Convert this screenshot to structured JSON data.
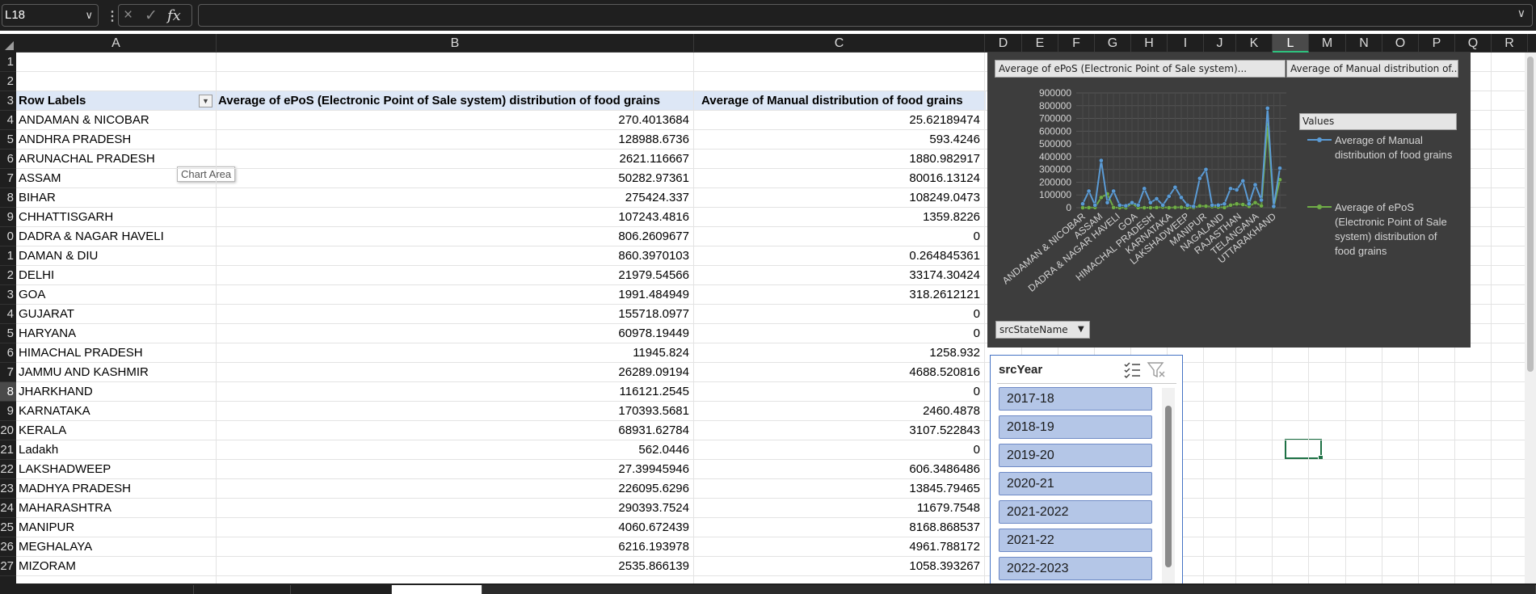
{
  "formula_bar": {
    "name_box": "L18",
    "dropdown_icon": "chevron-down-icon",
    "separator": "⋮",
    "cancel_icon": "×",
    "enter_icon": "✓",
    "fx_label": "fx",
    "formula": ""
  },
  "columns": [
    "A",
    "B",
    "C",
    "D",
    "E",
    "F",
    "G",
    "H",
    "I",
    "J",
    "K",
    "L",
    "M",
    "N",
    "O",
    "P",
    "Q",
    "R"
  ],
  "selected_column": "L",
  "selected_row": "18",
  "row_numbers": [
    "1",
    "2",
    "3",
    "4",
    "5",
    "6",
    "7",
    "8",
    "9",
    "0",
    "1",
    "2",
    "3",
    "4",
    "5",
    "6",
    "7",
    "8",
    "9",
    "20",
    "21",
    "22",
    "23",
    "24",
    "25",
    "26",
    "27"
  ],
  "pivot": {
    "headers": {
      "row_labels": "Row Labels",
      "epos": "Average of ePoS (Electronic Point of Sale system) distribution of food grains",
      "manual": "Average of Manual distribution of food grains"
    },
    "rows": [
      {
        "label": "ANDAMAN & NICOBAR",
        "epos": "270.4013684",
        "manual": "25.62189474"
      },
      {
        "label": "ANDHRA PRADESH",
        "epos": "128988.6736",
        "manual": "593.4246"
      },
      {
        "label": "ARUNACHAL PRADESH",
        "epos": "2621.116667",
        "manual": "1880.982917"
      },
      {
        "label": "ASSAM",
        "epos": "50282.97361",
        "manual": "80016.13124"
      },
      {
        "label": "BIHAR",
        "epos": "275424.337",
        "manual": "108249.0473"
      },
      {
        "label": "CHHATTISGARH",
        "epos": "107243.4816",
        "manual": "1359.8226"
      },
      {
        "label": "DADRA & NAGAR HAVELI",
        "epos": "806.2609677",
        "manual": "0"
      },
      {
        "label": "DAMAN & DIU",
        "epos": "860.3970103",
        "manual": "0.264845361"
      },
      {
        "label": "DELHI",
        "epos": "21979.54566",
        "manual": "33174.30424"
      },
      {
        "label": "GOA",
        "epos": "1991.484949",
        "manual": "318.2612121"
      },
      {
        "label": "GUJARAT",
        "epos": "155718.0977",
        "manual": "0"
      },
      {
        "label": "HARYANA",
        "epos": "60978.19449",
        "manual": "0"
      },
      {
        "label": "HIMACHAL PRADESH",
        "epos": "11945.824",
        "manual": "1258.932"
      },
      {
        "label": "JAMMU AND KASHMIR",
        "epos": "26289.09194",
        "manual": "4688.520816"
      },
      {
        "label": "JHARKHAND",
        "epos": "116121.2545",
        "manual": "0"
      },
      {
        "label": "KARNATAKA",
        "epos": "170393.5681",
        "manual": "2460.4878"
      },
      {
        "label": "KERALA",
        "epos": "68931.62784",
        "manual": "3107.522843"
      },
      {
        "label": "Ladakh",
        "epos": "562.0446",
        "manual": "0"
      },
      {
        "label": "LAKSHADWEEP",
        "epos": "27.39945946",
        "manual": "606.3486486"
      },
      {
        "label": "MADHYA PRADESH",
        "epos": "226095.6296",
        "manual": "13845.79465"
      },
      {
        "label": "MAHARASHTRA",
        "epos": "290393.7524",
        "manual": "11679.7548"
      },
      {
        "label": "MANIPUR",
        "epos": "4060.672439",
        "manual": "8168.868537"
      },
      {
        "label": "MEGHALAYA",
        "epos": "6216.193978",
        "manual": "4961.788172"
      },
      {
        "label": "MIZORAM",
        "epos": "2535.866139",
        "manual": "1058.393267"
      }
    ]
  },
  "tooltip": "Chart Area",
  "chart": {
    "field_tag_1": "Average of ePoS (Electronic Point of Sale system)...",
    "field_tag_2": "Average of Manual distribution of...",
    "legend_title": "Values",
    "legend_1": "Average of Manual distribution of food grains",
    "legend_2": "Average of ePoS (Electronic Point of Sale system) distribution of food grains",
    "field_button": "srcStateName",
    "colors": {
      "manual": "#5b9bd5",
      "epos": "#70ad47"
    }
  },
  "chart_data": {
    "type": "line",
    "ylim": [
      0,
      900000
    ],
    "yticks": [
      "900000",
      "800000",
      "700000",
      "600000",
      "500000",
      "400000",
      "300000",
      "200000",
      "100000",
      "0"
    ],
    "xtick_labels": [
      "ANDAMAN & NICOBAR",
      "ASSAM",
      "DADRA & NAGAR HAVELI",
      "GOA",
      "HIMACHAL PRADESH",
      "KARNATAKA",
      "LAKSHADWEEP",
      "MANIPUR",
      "NAGALAND",
      "RAJASTHAN",
      "TELANGANA",
      "UTTARAKHAND"
    ],
    "series": [
      {
        "name": "Average of Manual distribution of food grains",
        "values": [
          30000,
          130000,
          20000,
          370000,
          40000,
          130000,
          20000,
          15000,
          40000,
          20000,
          150000,
          40000,
          70000,
          20000,
          90000,
          160000,
          80000,
          20000,
          10000,
          230000,
          300000,
          20000,
          20000,
          30000,
          150000,
          140000,
          210000,
          30000,
          180000,
          60000,
          780000,
          10000,
          310000
        ]
      },
      {
        "name": "Average of ePoS (Electronic Point of Sale system) distribution of food grains",
        "values": [
          25,
          593,
          1881,
          80016,
          108249,
          1360,
          0,
          0,
          33174,
          318,
          0,
          0,
          1259,
          4689,
          0,
          2460,
          3108,
          0,
          606,
          13846,
          11680,
          8169,
          4962,
          1058,
          20000,
          30000,
          25000,
          10000,
          40000,
          15000,
          650000,
          5000,
          220000
        ]
      }
    ]
  },
  "slicer": {
    "title": "srcYear",
    "multiselect_icon": "multi-select-icon",
    "clear_filter_icon": "clear-filter-icon",
    "items": [
      "2017-18",
      "2018-19",
      "2019-20",
      "2020-21",
      "2021-2022",
      "2021-22",
      "2022-2023"
    ]
  }
}
